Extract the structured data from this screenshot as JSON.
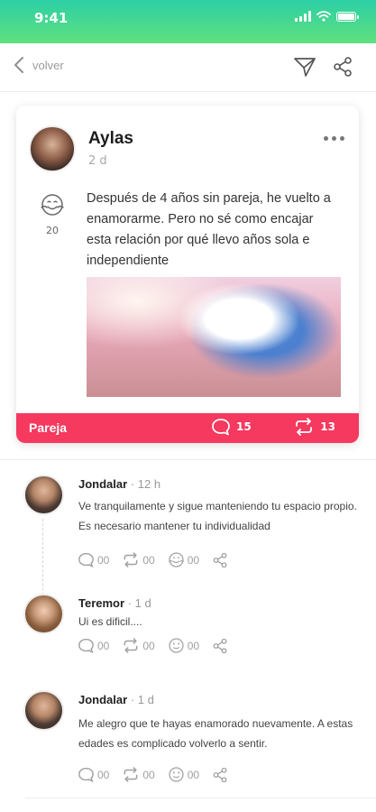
{
  "status": {
    "time": "9:41"
  },
  "nav": {
    "back_label": "volver"
  },
  "post": {
    "author": "Aylas",
    "time": "2 d",
    "reaction_count": "20",
    "text": "Después de 4 años sin pareja, he vuelto a enamorarme. Pero no sé como encajar esta relación por qué llevo años sola e independiente",
    "category": "Pareja",
    "comments_count": "15",
    "shares_count": "13"
  },
  "comments": [
    {
      "name": "Jondalar",
      "time": "· 12 h",
      "text": "Ve tranquilamente y sigue manteniendo tu espacio propio. Es necesario mantener tu individualidad",
      "replies": "00",
      "reposts": "00",
      "reactions": "00"
    },
    {
      "name": "Teremor",
      "time": "· 1 d",
      "text": "Ui es dificil....",
      "replies": "00",
      "reposts": "00",
      "reactions": "00"
    },
    {
      "name": "Jondalar",
      "time": "· 1 d",
      "text": "Me alegro que te hayas enamorado nuevamente. A estas edades es complicado volverlo a sentir.",
      "replies": "00",
      "reposts": "00",
      "reactions": "00"
    }
  ],
  "colors": {
    "status_gradient_top": "#2dcfa5",
    "status_gradient_bottom": "#5fe07e",
    "accent": "#f5395f"
  },
  "icons": [
    "back-chevron-icon",
    "send-icon",
    "share-icon",
    "more-icon",
    "hug-emoji-icon",
    "comment-icon",
    "repost-icon",
    "emoji-icon"
  ]
}
